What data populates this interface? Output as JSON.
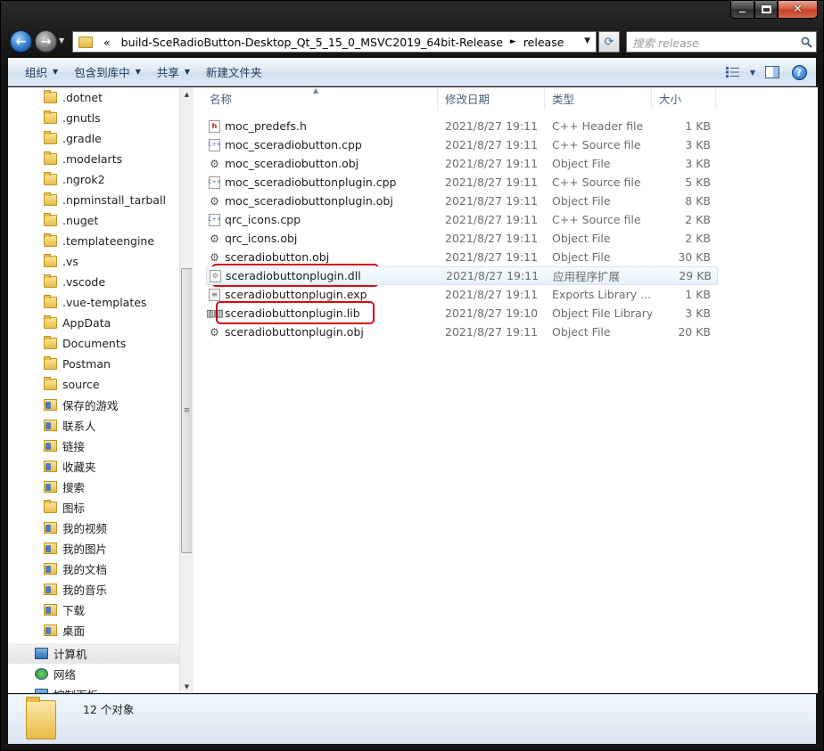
{
  "address": {
    "overflow": "«",
    "segments": [
      "build-SceRadioButton-Desktop_Qt_5_15_0_MSVC2019_64bit-Release",
      "release"
    ]
  },
  "search": {
    "placeholder": "搜索 release"
  },
  "toolbar": {
    "organize": "组织",
    "include_in_library": "包含到库中",
    "share": "共享",
    "new_folder": "新建文件夹"
  },
  "nav": {
    "items": [
      {
        "label": ".dotnet",
        "icon": "folder-icon"
      },
      {
        "label": ".gnutls",
        "icon": "folder-icon"
      },
      {
        "label": ".gradle",
        "icon": "folder-icon"
      },
      {
        "label": ".modelarts",
        "icon": "folder-icon"
      },
      {
        "label": ".ngrok2",
        "icon": "folder-icon"
      },
      {
        "label": ".npminstall_tarball",
        "icon": "folder-icon"
      },
      {
        "label": ".nuget",
        "icon": "folder-icon"
      },
      {
        "label": ".templateengine",
        "icon": "folder-icon"
      },
      {
        "label": ".vs",
        "icon": "folder-icon"
      },
      {
        "label": ".vscode",
        "icon": "folder-icon"
      },
      {
        "label": ".vue-templates",
        "icon": "folder-icon"
      },
      {
        "label": "AppData",
        "icon": "folder-icon"
      },
      {
        "label": "Documents",
        "icon": "folder-icon"
      },
      {
        "label": "Postman",
        "icon": "folder-icon"
      },
      {
        "label": "source",
        "icon": "folder-icon"
      },
      {
        "label": "保存的游戏",
        "icon": "saved-games-icon"
      },
      {
        "label": "联系人",
        "icon": "contacts-icon"
      },
      {
        "label": "链接",
        "icon": "links-icon"
      },
      {
        "label": "收藏夹",
        "icon": "favorites-icon"
      },
      {
        "label": "搜索",
        "icon": "searches-icon"
      },
      {
        "label": "图标",
        "icon": "folder-icon"
      },
      {
        "label": "我的视频",
        "icon": "videos-icon"
      },
      {
        "label": "我的图片",
        "icon": "pictures-icon"
      },
      {
        "label": "我的文档",
        "icon": "documents-icon"
      },
      {
        "label": "我的音乐",
        "icon": "music-icon"
      },
      {
        "label": "下载",
        "icon": "downloads-icon"
      },
      {
        "label": "桌面",
        "icon": "desktop-icon"
      }
    ],
    "computer": "计算机",
    "network": "网络",
    "control_panel": "控制面板"
  },
  "columns": {
    "name": "名称",
    "date": "修改日期",
    "type": "类型",
    "size": "大小"
  },
  "files": [
    {
      "name": "moc_predefs.h",
      "date": "2021/8/27 19:11",
      "type": "C++ Header file",
      "size": "1 KB",
      "icon": "header-file-icon"
    },
    {
      "name": "moc_sceradiobutton.cpp",
      "date": "2021/8/27 19:11",
      "type": "C++ Source file",
      "size": "3 KB",
      "icon": "cpp-file-icon"
    },
    {
      "name": "moc_sceradiobutton.obj",
      "date": "2021/8/27 19:11",
      "type": "Object File",
      "size": "3 KB",
      "icon": "obj-file-icon"
    },
    {
      "name": "moc_sceradiobuttonplugin.cpp",
      "date": "2021/8/27 19:11",
      "type": "C++ Source file",
      "size": "5 KB",
      "icon": "cpp-file-icon"
    },
    {
      "name": "moc_sceradiobuttonplugin.obj",
      "date": "2021/8/27 19:11",
      "type": "Object File",
      "size": "8 KB",
      "icon": "obj-file-icon"
    },
    {
      "name": "qrc_icons.cpp",
      "date": "2021/8/27 19:11",
      "type": "C++ Source file",
      "size": "2 KB",
      "icon": "cpp-file-icon"
    },
    {
      "name": "qrc_icons.obj",
      "date": "2021/8/27 19:11",
      "type": "Object File",
      "size": "2 KB",
      "icon": "obj-file-icon"
    },
    {
      "name": "sceradiobutton.obj",
      "date": "2021/8/27 19:11",
      "type": "Object File",
      "size": "30 KB",
      "icon": "obj-file-icon"
    },
    {
      "name": "sceradiobuttonplugin.dll",
      "date": "2021/8/27 19:11",
      "type": "应用程序扩展",
      "size": "29 KB",
      "icon": "dll-file-icon",
      "selected": true
    },
    {
      "name": "sceradiobuttonplugin.exp",
      "date": "2021/8/27 19:11",
      "type": "Exports Library ...",
      "size": "1 KB",
      "icon": "exp-file-icon"
    },
    {
      "name": "sceradiobuttonplugin.lib",
      "date": "2021/8/27 19:10",
      "type": "Object File Library",
      "size": "3 KB",
      "icon": "lib-file-icon"
    },
    {
      "name": "sceradiobuttonplugin.obj",
      "date": "2021/8/27 19:11",
      "type": "Object File",
      "size": "20 KB",
      "icon": "obj-file-icon"
    }
  ],
  "status": {
    "count": "12 个对象"
  },
  "colors": {
    "highlight_box": "#d01010",
    "selection": "#e8f2fb"
  }
}
